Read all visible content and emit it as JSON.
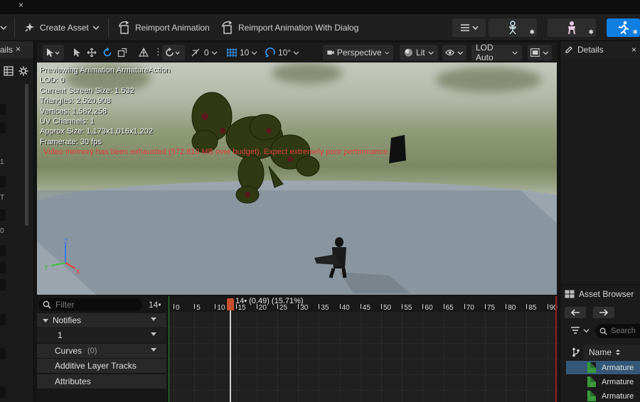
{
  "left_panel": {
    "tab_label": "ails",
    "tab_close": "×",
    "glyphs": [
      "1",
      "T",
      "0"
    ]
  },
  "toolbar": {
    "create_asset": "Create Asset",
    "reimport": "Reimport Animation",
    "reimport_dialog": "Reimport Animation With Dialog"
  },
  "viewport_toolbar": {
    "rotation_value": "0",
    "grid_value": "10",
    "angle_value": "10°",
    "perspective": "Perspective",
    "lit": "Lit",
    "lod": "LOD Auto"
  },
  "viewport": {
    "stats": [
      "Previewing Animation ArmatureAction",
      "LOD: 0",
      "Current Screen Size: 1.532",
      "Triangles: 2,520,908",
      "Vertices: 1,582,258",
      "UV Channels: 1",
      "Approx Size: 1,173x1,016x1,202",
      "Framerate: 30 fps"
    ],
    "warning": "Video memory has been exhausted (572.810 MB over budget). Expect extremely poor performance.",
    "axes": {
      "x": "X",
      "y": "Y",
      "z": "Z"
    }
  },
  "tracks": {
    "filter_placeholder": "Filter",
    "frame_count": "14•",
    "notifies": "Notifies",
    "notify_track": "1",
    "curves": "Curves",
    "curves_count": "(0)",
    "additive": "Additive Layer Tracks",
    "attributes": "Attributes"
  },
  "timeline": {
    "scrub_text": "14• (0.49) (15.71%)",
    "ticks": [
      "0",
      "5",
      "10",
      "15",
      "20",
      "25",
      "30",
      "35",
      "40",
      "45",
      "50",
      "55",
      "60",
      "65",
      "70",
      "75",
      "80",
      "85",
      "90"
    ]
  },
  "details": {
    "title": "Details",
    "close": "×"
  },
  "asset_browser": {
    "title": "Asset Browser",
    "search_placeholder": "Search",
    "column": "Name",
    "items": [
      "Armature",
      "Armature",
      "Armature"
    ]
  },
  "colors": {
    "accent": "#0f7fe2",
    "warning": "#e13c3c",
    "scrub": "#c8502e",
    "selection": "#355878"
  }
}
